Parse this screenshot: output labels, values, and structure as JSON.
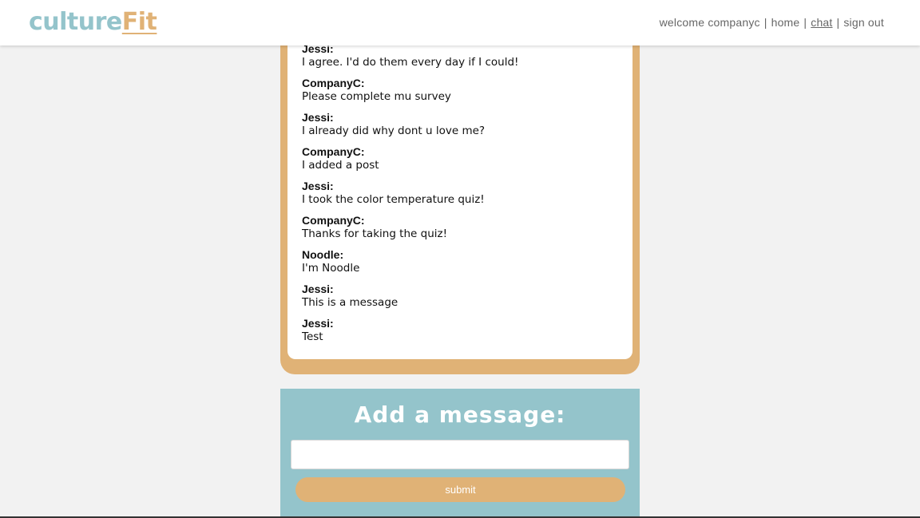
{
  "app": {
    "logo_part1": "culture",
    "logo_part2": "Fit",
    "colors": {
      "teal": "#94c4cb",
      "tan": "#e0b276",
      "background": "#f2f2f2"
    }
  },
  "nav": {
    "welcome": "welcome companyc",
    "sep": "|",
    "home": "home",
    "chat": "chat",
    "sign_out": "sign out",
    "active": "chat"
  },
  "chat": {
    "messages": [
      {
        "author": "Jessi:",
        "text": "I agree. I'd do them every day if I could!"
      },
      {
        "author": "CompanyC:",
        "text": "Please complete mu survey"
      },
      {
        "author": "Jessi:",
        "text": "I already did why dont u love me?"
      },
      {
        "author": "CompanyC:",
        "text": "I added a post"
      },
      {
        "author": "Jessi:",
        "text": "I took the color temperature quiz!"
      },
      {
        "author": "CompanyC:",
        "text": "Thanks for taking the quiz!"
      },
      {
        "author": "Noodle:",
        "text": "I'm Noodle"
      },
      {
        "author": "Jessi:",
        "text": "This is a message"
      },
      {
        "author": "Jessi:",
        "text": "Test"
      }
    ]
  },
  "compose": {
    "title": "Add a message:",
    "input_value": "",
    "input_placeholder": "",
    "submit_label": "submit"
  }
}
